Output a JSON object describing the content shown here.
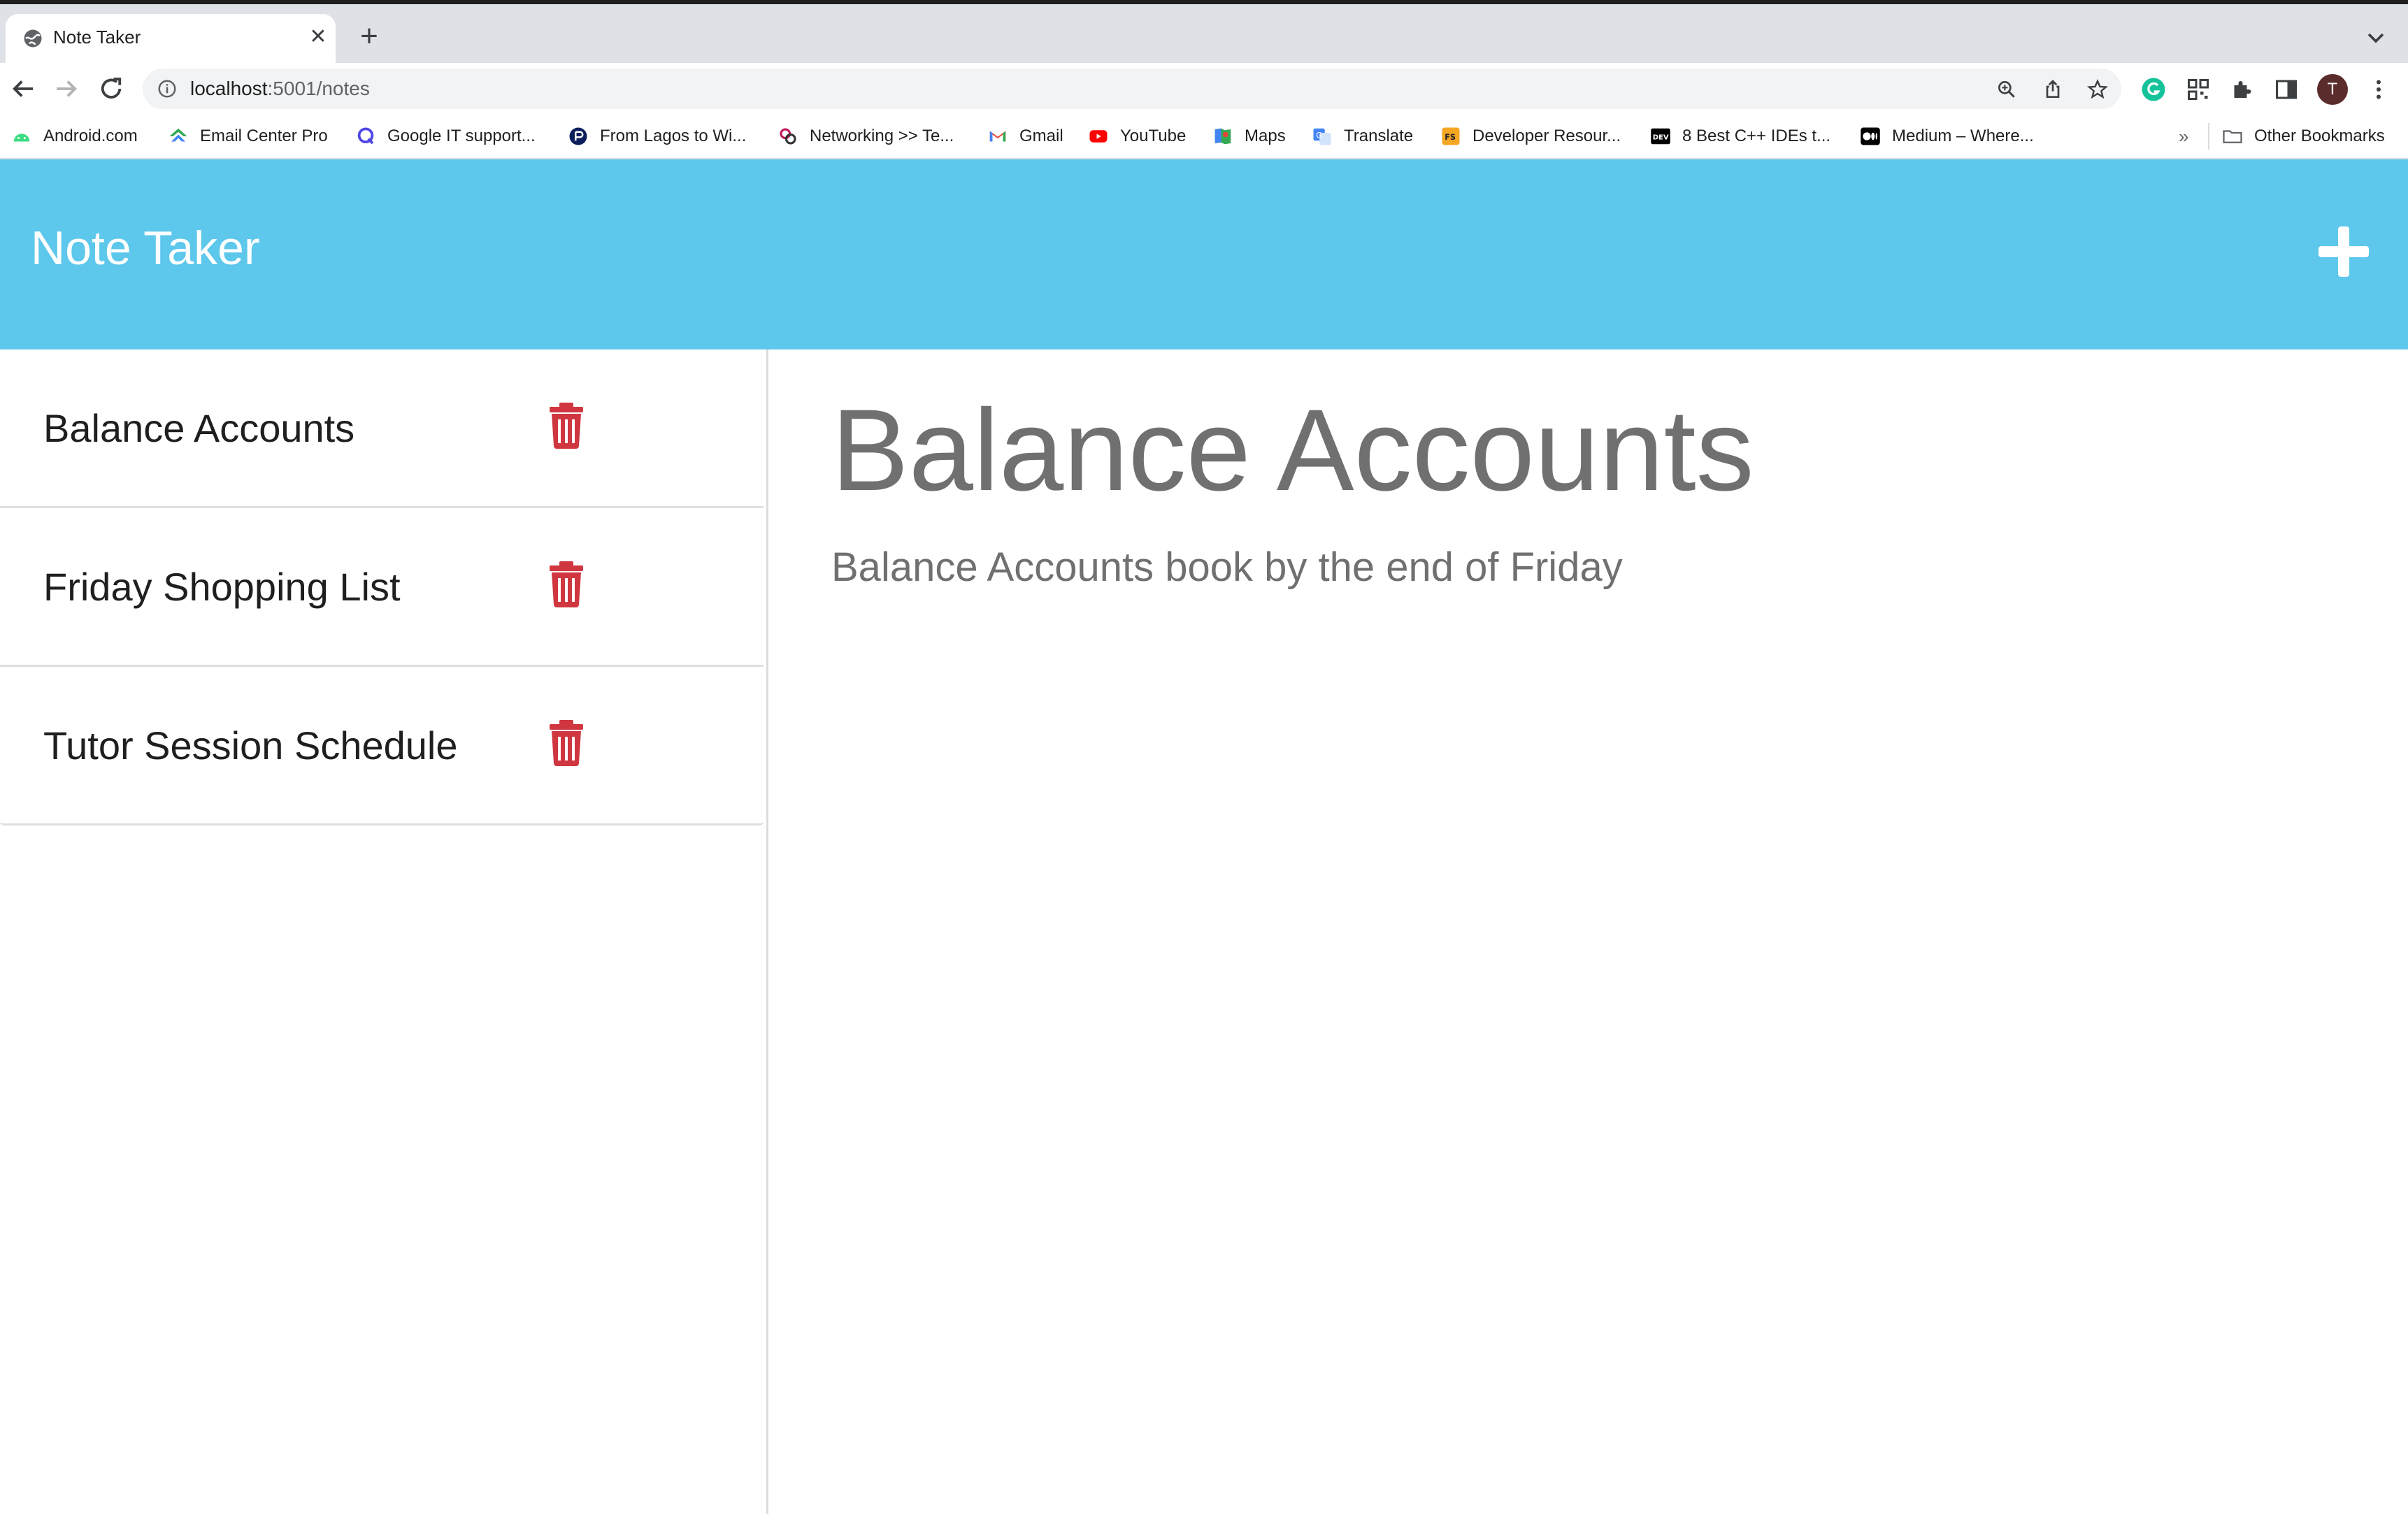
{
  "browser": {
    "tab": {
      "title": "Note Taker"
    },
    "url": {
      "host": "localhost",
      "path": ":5001/notes"
    },
    "profile_initial": "T",
    "bookmarks": [
      {
        "label": "Android.com",
        "icon": "android-icon",
        "color": "#3ddc84"
      },
      {
        "label": "Email Center Pro",
        "icon": "email-center-icon",
        "color": "#34a853"
      },
      {
        "label": "Google IT support...",
        "icon": "q-icon",
        "color": "#4f46e5"
      },
      {
        "label": "From Lagos to Wi...",
        "icon": "circle-logo-icon",
        "color": "#0b1f5c"
      },
      {
        "label": "Networking >> Te...",
        "icon": "networking-icon",
        "color": "#c2185b"
      },
      {
        "label": "Gmail",
        "icon": "gmail-icon",
        "color": "#ea4335"
      },
      {
        "label": "YouTube",
        "icon": "youtube-icon",
        "color": "#ff0000"
      },
      {
        "label": "Maps",
        "icon": "maps-icon",
        "color": "#34a853"
      },
      {
        "label": "Translate",
        "icon": "translate-icon",
        "color": "#4285f4"
      },
      {
        "label": "Developer Resour...",
        "icon": "fs-icon",
        "color": "#f5a623"
      },
      {
        "label": "8 Best C++ IDEs t...",
        "icon": "dev-icon",
        "color": "#000000"
      },
      {
        "label": "Medium – Where...",
        "icon": "medium-icon",
        "color": "#000000"
      }
    ],
    "bookmarks_overflow": "»",
    "other_bookmarks": "Other Bookmarks"
  },
  "app": {
    "title": "Note Taker",
    "header_color": "#5dc7ec",
    "add_icon": "plus-icon"
  },
  "notes": [
    {
      "title": "Balance Accounts"
    },
    {
      "title": "Friday Shopping List"
    },
    {
      "title": "Tutor Session Schedule"
    }
  ],
  "active_note": {
    "title": "Balance Accounts",
    "text": "Balance Accounts book by the end of Friday"
  },
  "colors": {
    "delete": "#d0363f",
    "note_text": "#707070"
  }
}
